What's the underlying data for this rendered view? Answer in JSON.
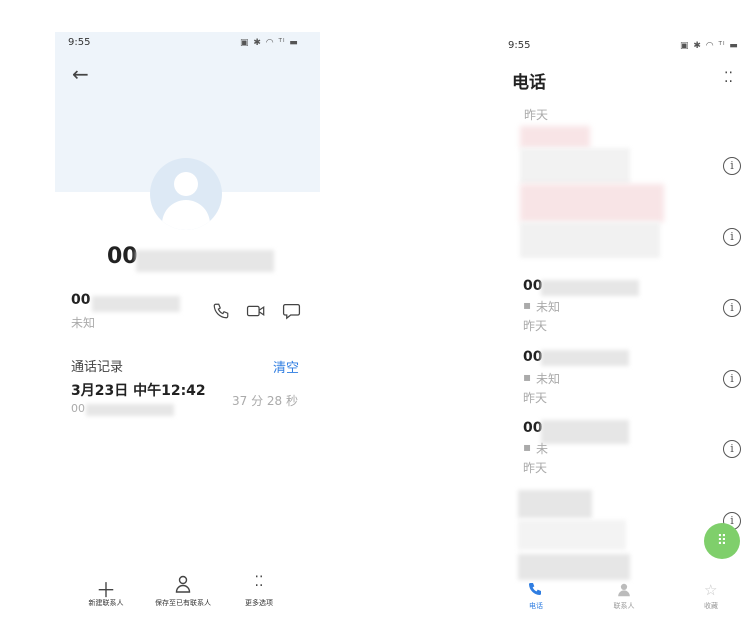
{
  "left": {
    "status_time": "9:55",
    "status_icons": "▣ ✱ ◠ ᵀˡ ▬",
    "back_icon": "←",
    "name_prefix": "00",
    "number_prefix": "00",
    "number_type": "未知",
    "call_log_title": "通话记录",
    "clear_label": "清空",
    "call_date": "3月23日 中午12:42",
    "call_number_prefix": "00",
    "call_duration": "37 分 28 秒",
    "toolbar": {
      "new_contact": "新建联系人",
      "save_existing": "保存至已有联系人",
      "more": "更多选项"
    }
  },
  "right": {
    "status_time": "9:55",
    "status_icons": "▣ ✱ ◠ ᵀˡ ▬",
    "title": "电话",
    "menu_icon": "⁚⁚",
    "yesterday_top": "昨天",
    "calls": [
      {
        "number": "00",
        "type": "未知",
        "time": "昨天"
      },
      {
        "number": "00",
        "type": "未知",
        "time": "昨天"
      },
      {
        "number": "00",
        "type": "未",
        "time": "昨天"
      }
    ],
    "tabs": {
      "phone": "电话",
      "contacts": "联系人",
      "favorites": "收藏"
    }
  },
  "colors": {
    "accent": "#2f7de1",
    "fab": "#7fcf6b",
    "header_bg": "#eef4fa"
  }
}
